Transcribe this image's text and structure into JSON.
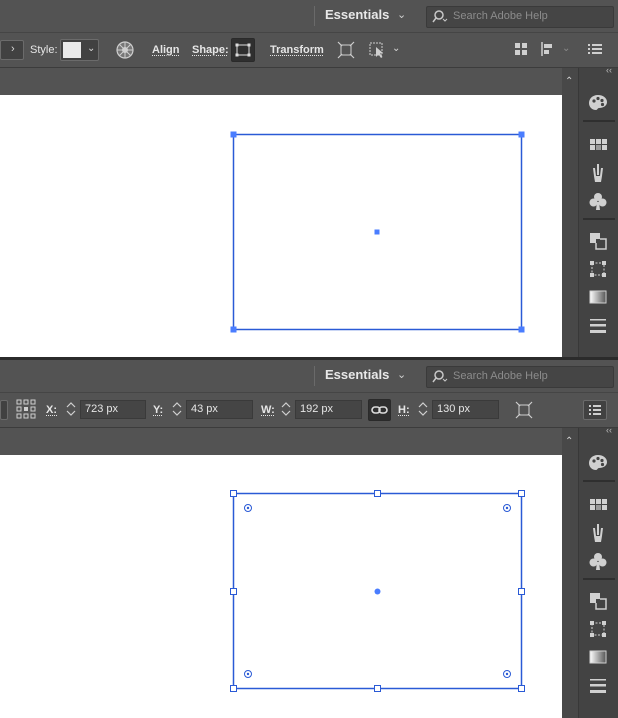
{
  "top_bar": {
    "workspace_label": "Essentials",
    "search_placeholder": "Search Adobe Help"
  },
  "panel_1": {
    "control_bar": {
      "style_label": "Style:",
      "align_label": "Align",
      "shape_label": "Shape:",
      "transform_label": "Transform"
    }
  },
  "panel_2": {
    "control_bar": {
      "x_label": "X:",
      "x_value": "723 px",
      "y_label": "Y:",
      "y_value": "43 px",
      "w_label": "W:",
      "w_value": "192 px",
      "h_label": "H:",
      "h_value": "130 px"
    }
  },
  "icons": [
    "search-icon",
    "chevron-down-icon",
    "recolor-artwork-icon",
    "shape-rectangle-icon",
    "isolate-object-icon",
    "select-similar-icon",
    "distribute-icon",
    "align-menu-icon",
    "panel-menu-icon",
    "reference-point-icon",
    "link-icon",
    "collapse-icon",
    "color-palette-icon",
    "swatches-icon",
    "brushes-icon",
    "symbols-icon",
    "pathfinder-icon",
    "transform-panel-icon",
    "gradient-icon",
    "stroke-icon"
  ],
  "colors": {
    "ui_background": "#535353",
    "selection_blue": "#2a5ad6",
    "anchor_blue": "#4a7dff"
  }
}
